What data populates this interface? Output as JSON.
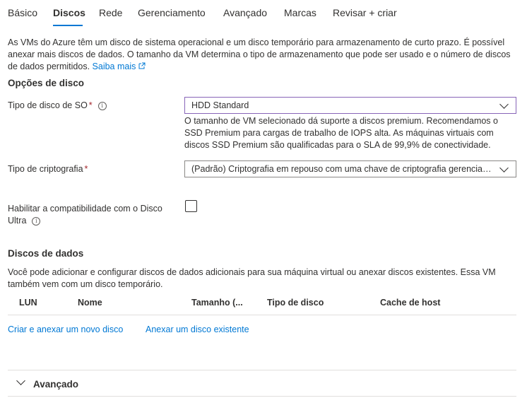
{
  "tabs": [
    {
      "label": "Básico"
    },
    {
      "label": "Discos"
    },
    {
      "label": "Rede"
    },
    {
      "label": "Gerenciamento"
    },
    {
      "label": "Avançado"
    },
    {
      "label": "Marcas"
    },
    {
      "label": "Revisar + criar"
    }
  ],
  "intro": {
    "text": "As VMs do Azure têm um disco de sistema operacional e um disco temporário para armazenamento de curto prazo. É possível anexar mais discos de dados. O tamanho da VM determina o tipo de armazenamento que pode ser usado e o número de discos de dados permitidos.",
    "link": "Saiba mais"
  },
  "disk_options": {
    "title": "Opções de disco",
    "os_disk_label": "Tipo de disco de SO",
    "os_disk_value": "HDD Standard",
    "os_disk_note": "O tamanho de VM selecionado dá suporte a discos premium. Recomendamos o SSD Premium para cargas de trabalho de IOPS alta. As máquinas virtuais com discos SSD Premium são qualificadas para o SLA de 99,9% de conectividade.",
    "encryption_label": "Tipo de criptografia",
    "encryption_value": "(Padrão) Criptografia em repouso com uma chave de criptografia gerenciada pela plataforma",
    "ultra_label": "Habilitar a compatibilidade com o Disco Ultra",
    "required_mark": "*",
    "info_glyph": "i"
  },
  "data_disks": {
    "title": "Discos de dados",
    "description": "Você pode adicionar e configurar discos de dados adicionais para sua máquina virtual ou anexar discos existentes. Essa VM também vem com um disco temporário.",
    "columns": [
      "LUN",
      "Nome",
      "Tamanho (...",
      "Tipo de disco",
      "Cache de host"
    ],
    "create_link": "Criar e anexar um novo disco",
    "attach_link": "Anexar um disco existente"
  },
  "advanced": {
    "label": "Avançado"
  },
  "colors": {
    "accent": "#0078d4",
    "focus_border": "#8764b8",
    "required": "#a4262c"
  }
}
